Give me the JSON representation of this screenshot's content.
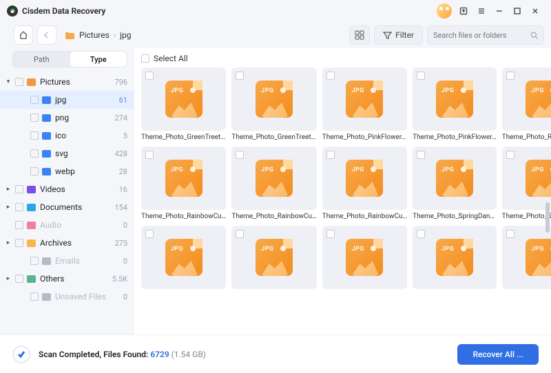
{
  "app": {
    "title": "Cisdem Data Recovery"
  },
  "breadcrumb": {
    "parent": "Pictures",
    "current": "jpg"
  },
  "toolbar": {
    "filter_label": "Filter",
    "search_placeholder": "Search files or folders"
  },
  "tabs": {
    "path": "Path",
    "type": "Type"
  },
  "tree": [
    {
      "kind": "parent",
      "expanded": true,
      "icon": "#f59842",
      "label": "Pictures",
      "count": "796"
    },
    {
      "kind": "child",
      "active": true,
      "icon": "#3b82f6",
      "label": "jpg",
      "count": "61"
    },
    {
      "kind": "child",
      "icon": "#3b82f6",
      "label": "png",
      "count": "274"
    },
    {
      "kind": "child",
      "icon": "#3b82f6",
      "label": "ico",
      "count": "5"
    },
    {
      "kind": "child",
      "icon": "#3b82f6",
      "label": "svg",
      "count": "428"
    },
    {
      "kind": "child",
      "icon": "#3b82f6",
      "label": "webp",
      "count": "28"
    },
    {
      "kind": "parent",
      "expanded": false,
      "icon": "#7c4ded",
      "label": "Videos",
      "count": "16"
    },
    {
      "kind": "parent",
      "expanded": false,
      "icon": "#2aa8e6",
      "label": "Documents",
      "count": "154"
    },
    {
      "kind": "parent",
      "muted": true,
      "noexpand": true,
      "icon": "#f07fa2",
      "label": "Audio",
      "count": "0"
    },
    {
      "kind": "parent",
      "expanded": false,
      "icon": "#f6b84a",
      "label": "Archives",
      "count": "275"
    },
    {
      "kind": "child",
      "muted": true,
      "icon": "#b6bac6",
      "label": "Emails",
      "count": "0"
    },
    {
      "kind": "parent",
      "expanded": false,
      "icon": "#5bb58c",
      "label": "Others",
      "count": "5.5K"
    },
    {
      "kind": "child",
      "muted": true,
      "icon": "#b6bac6",
      "label": "Unsaved Files",
      "count": "0"
    }
  ],
  "select_all": "Select All",
  "files": [
    "Theme_Photo_GreenTreet…",
    "Theme_Photo_GreenTreet…",
    "Theme_Photo_PinkFlower…",
    "Theme_Photo_PinkFlower…",
    "Theme_Photo_RainbowCu…",
    "Theme_Photo_RainbowCu…",
    "Theme_Photo_RainbowCu…",
    "Theme_Photo_RainbowCu…",
    "Theme_Photo_SpringDan…",
    "Theme_Photo_SpringDan…",
    "",
    "",
    "",
    "",
    ""
  ],
  "icon_tag": "JPG",
  "status": {
    "prefix": "Scan Completed, Files Found: ",
    "count": "6729",
    "size": " (1.54 GB)"
  },
  "recover_label": "Recover All ..."
}
